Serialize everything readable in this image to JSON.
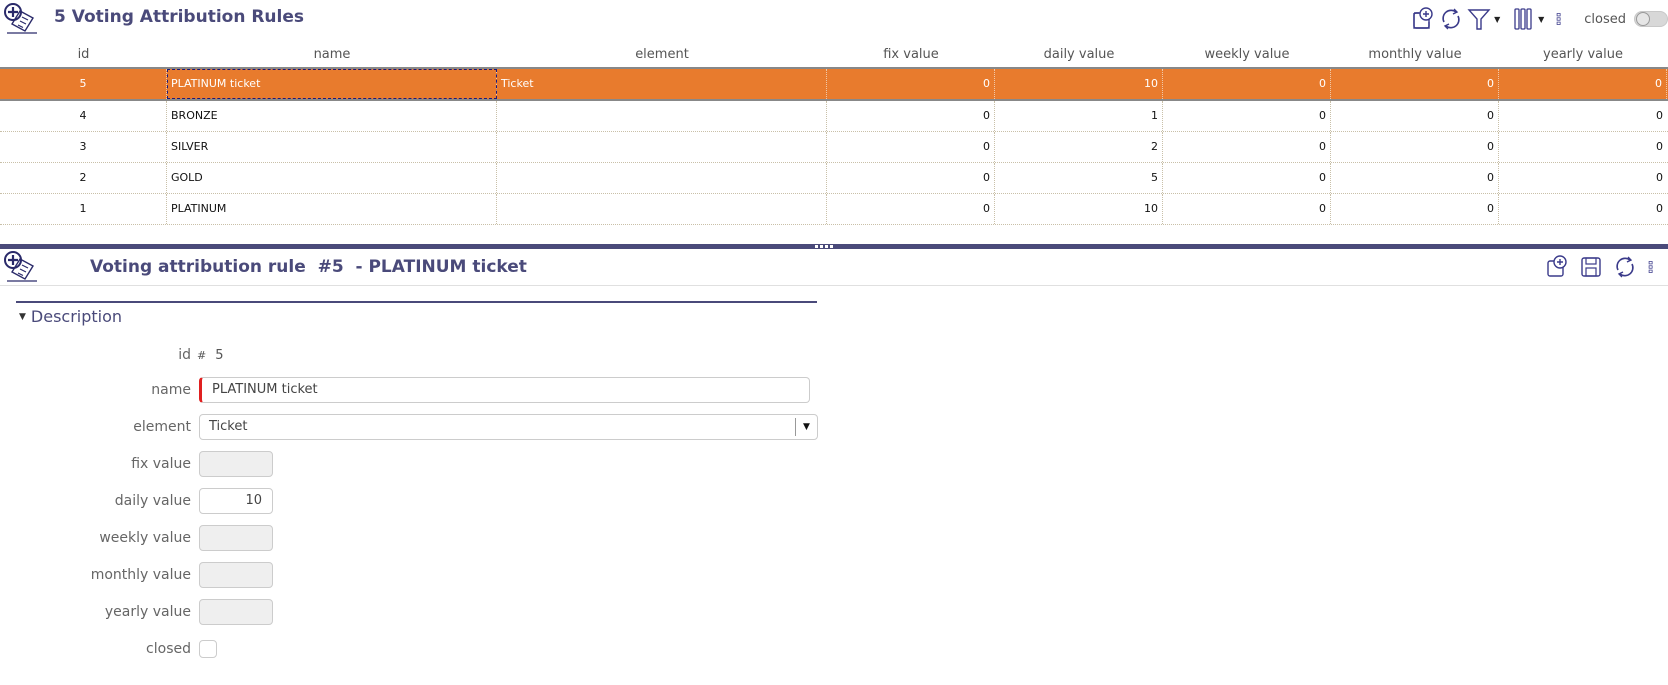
{
  "list": {
    "title": "5 Voting Attribution Rules",
    "toolbar": {
      "icons": [
        "new-record-icon",
        "refresh-icon",
        "filter-icon",
        "columns-icon",
        "more-options-icon"
      ],
      "closed_toggle_label": "closed",
      "closed_toggle_on": false
    },
    "columns": [
      "id",
      "name",
      "element",
      "fix value",
      "daily value",
      "weekly value",
      "monthly value",
      "yearly value"
    ],
    "rows": [
      {
        "id": "5",
        "name": "PLATINUM ticket",
        "element": "Ticket",
        "fix": "0",
        "daily": "10",
        "weekly": "0",
        "monthly": "0",
        "yearly": "0",
        "selected": true
      },
      {
        "id": "4",
        "name": "BRONZE",
        "element": "",
        "fix": "0",
        "daily": "1",
        "weekly": "0",
        "monthly": "0",
        "yearly": "0"
      },
      {
        "id": "3",
        "name": "SILVER",
        "element": "",
        "fix": "0",
        "daily": "2",
        "weekly": "0",
        "monthly": "0",
        "yearly": "0"
      },
      {
        "id": "2",
        "name": "GOLD",
        "element": "",
        "fix": "0",
        "daily": "5",
        "weekly": "0",
        "monthly": "0",
        "yearly": "0"
      },
      {
        "id": "1",
        "name": "PLATINUM",
        "element": "",
        "fix": "0",
        "daily": "10",
        "weekly": "0",
        "monthly": "0",
        "yearly": "0"
      }
    ],
    "selected_color": "#e87b2d"
  },
  "detail": {
    "title": "Voting attribution rule  #5  - PLATINUM ticket",
    "toolbar": {
      "icons": [
        "new-record-icon",
        "save-icon",
        "refresh-icon",
        "more-options-icon"
      ]
    },
    "section": "Description",
    "fields": {
      "id_label": "id",
      "id_hash": "#",
      "id_value": "5",
      "name_label": "name",
      "name_value": "PLATINUM ticket",
      "element_label": "element",
      "element_value": "Ticket",
      "fix_label": "fix value",
      "fix_value": "",
      "daily_label": "daily value",
      "daily_value": "10",
      "weekly_label": "weekly value",
      "weekly_value": "",
      "monthly_label": "monthly value",
      "monthly_value": "",
      "yearly_label": "yearly value",
      "yearly_value": "",
      "closed_label": "closed",
      "closed_checked": false
    }
  },
  "colors": {
    "accent_navy": "#4a4a7a",
    "selected_row": "#e87b2d",
    "required_marker": "#e02020"
  }
}
